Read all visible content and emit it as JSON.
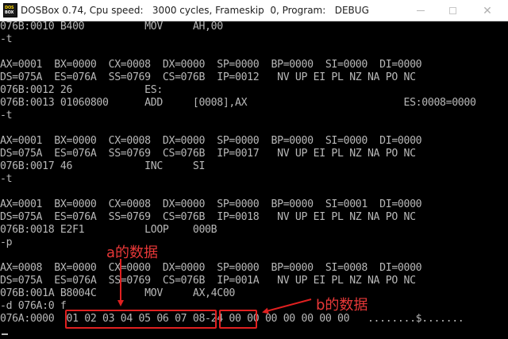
{
  "window": {
    "icon_line1": "DOS",
    "icon_line2": "BOX",
    "title": "DOSBox 0.74, Cpu speed:   3000 cycles, Frameskip  0, Program:   DEBUG",
    "close_glyph": "✕"
  },
  "console": {
    "lines": [
      "076B:0010 B400          MOV     AH,00",
      "-t",
      "",
      "AX=0001  BX=0000  CX=0008  DX=0000  SP=0000  BP=0000  SI=0000  DI=0000",
      "DS=075A  ES=076A  SS=0769  CS=076B  IP=0012   NV UP EI PL NZ NA PO NC",
      "076B:0012 26            ES:",
      "076B:0013 01060800      ADD     [0008],AX                          ES:0008=0000",
      "-t",
      "",
      "AX=0001  BX=0000  CX=0008  DX=0000  SP=0000  BP=0000  SI=0000  DI=0000",
      "DS=075A  ES=076A  SS=0769  CS=076B  IP=0017   NV UP EI PL NZ NA PO NC",
      "076B:0017 46            INC     SI",
      "-t",
      "",
      "AX=0001  BX=0000  CX=0008  DX=0000  SP=0000  BP=0000  SI=0001  DI=0000",
      "DS=075A  ES=076A  SS=0769  CS=076B  IP=0018   NV UP EI PL NZ NA PO NC",
      "076B:0018 E2F1          LOOP    000B",
      "-p",
      "",
      "AX=0008  BX=0000  CX=0000  DX=0000  SP=0000  BP=0000  SI=0008  DI=0000",
      "DS=075A  ES=076A  SS=0769  CS=076B  IP=001A   NV UP EI PL NZ NA PO NC",
      "076B:001A B8004C        MOV     AX,4C00",
      "-d 076A:0 f",
      "076A:0000  01 02 03 04 05 06 07 08-24 00 00 00 00 00 00 00   ........$......."
    ]
  },
  "annotations": {
    "a_label": "a的数据",
    "b_label": "b的数据",
    "color": "#e02020"
  }
}
